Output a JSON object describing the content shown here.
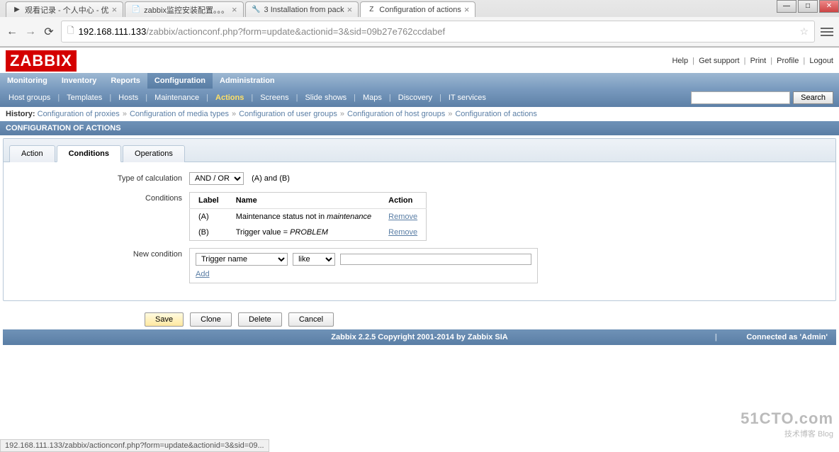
{
  "browser": {
    "tabs": [
      {
        "title": "观看记录 - 个人中心 - 优",
        "favicon": "▶"
      },
      {
        "title": "zabbix监控安装配置。。。",
        "favicon": "📄"
      },
      {
        "title": "3 Installation from pack",
        "favicon": "🔧"
      },
      {
        "title": "Configuration of actions",
        "favicon": "Z",
        "active": true
      }
    ],
    "url_host": "192.168.111.133",
    "url_path": "/zabbix/actionconf.php?form=update&actionid=3&sid=09b27e762ccdabef",
    "status_text": "192.168.111.133/zabbix/actionconf.php?form=update&actionid=3&sid=09..."
  },
  "top_links": {
    "help": "Help",
    "support": "Get support",
    "print": "Print",
    "profile": "Profile",
    "logout": "Logout"
  },
  "logo": "ZABBIX",
  "main_nav": {
    "items": [
      "Monitoring",
      "Inventory",
      "Reports",
      "Configuration",
      "Administration"
    ],
    "active_index": 3
  },
  "sub_nav": {
    "items": [
      "Host groups",
      "Templates",
      "Hosts",
      "Maintenance",
      "Actions",
      "Screens",
      "Slide shows",
      "Maps",
      "Discovery",
      "IT services"
    ],
    "active_index": 4,
    "search_button": "Search"
  },
  "history": {
    "label": "History:",
    "items": [
      "Configuration of proxies",
      "Configuration of media types",
      "Configuration of user groups",
      "Configuration of host groups",
      "Configuration of actions"
    ]
  },
  "page_title": "CONFIGURATION OF ACTIONS",
  "form_tabs": {
    "items": [
      "Action",
      "Conditions",
      "Operations"
    ],
    "active_index": 1
  },
  "form": {
    "calc_label": "Type of calculation",
    "calc_value": "AND / OR",
    "calc_result": "(A) and (B)",
    "conditions_label": "Conditions",
    "cond_headers": {
      "label": "Label",
      "name": "Name",
      "action": "Action"
    },
    "conditions": [
      {
        "label": "(A)",
        "name_pre": "Maintenance status not in ",
        "name_em": "maintenance",
        "action": "Remove"
      },
      {
        "label": "(B)",
        "name_pre": "Trigger value = ",
        "name_em": "PROBLEM",
        "action": "Remove"
      }
    ],
    "newcond_label": "New condition",
    "newcond_type": "Trigger name",
    "newcond_op": "like",
    "newcond_value": "",
    "add_link": "Add"
  },
  "buttons": {
    "save": "Save",
    "clone": "Clone",
    "delete": "Delete",
    "cancel": "Cancel"
  },
  "footer": {
    "copyright": "Zabbix 2.2.5 Copyright 2001-2014 by Zabbix SIA",
    "connected": "Connected as 'Admin'"
  },
  "watermark": {
    "big": "51CTO.com",
    "small": "技术博客    Blog"
  }
}
